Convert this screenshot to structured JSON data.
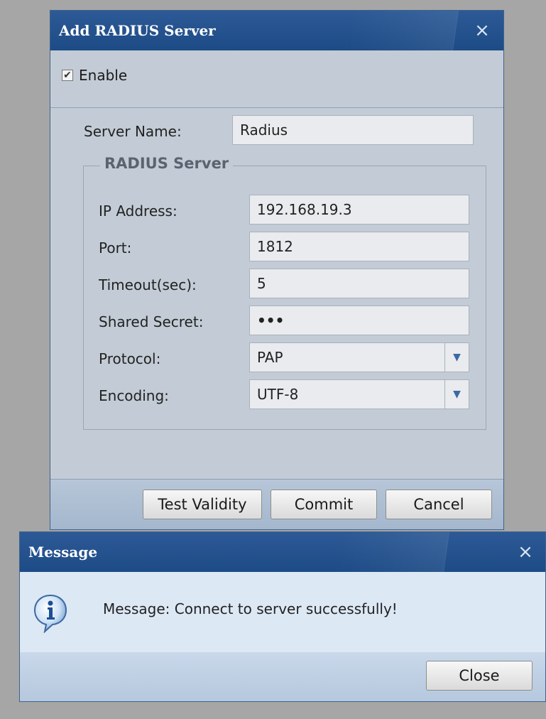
{
  "radius_dialog": {
    "title": "Add RADIUS Server",
    "close_symbol": "×",
    "enable": {
      "label": "Enable",
      "checked": true
    },
    "server_name": {
      "label": "Server Name:",
      "value": "Radius"
    },
    "group": {
      "legend": "RADIUS Server",
      "ip_address": {
        "label": "IP Address:",
        "value": "192.168.19.3"
      },
      "port": {
        "label": "Port:",
        "value": "1812"
      },
      "timeout": {
        "label": "Timeout(sec):",
        "value": "5"
      },
      "shared_secret": {
        "label": "Shared Secret:",
        "value": "•••"
      },
      "protocol": {
        "label": "Protocol:",
        "value": "PAP"
      },
      "encoding": {
        "label": "Encoding:",
        "value": "UTF-8"
      }
    },
    "buttons": {
      "test_validity": "Test Validity",
      "commit": "Commit",
      "cancel": "Cancel"
    }
  },
  "message_dialog": {
    "title": "Message",
    "close_symbol": "×",
    "text": "Message: Connect to server successfully!",
    "icon": "info-icon",
    "close_button": "Close"
  },
  "colors": {
    "titlebar": "#1d4b86",
    "dialog_body": "#c3ccd6",
    "message_body": "#dde8f5",
    "backdrop": "#a6a6a6"
  }
}
